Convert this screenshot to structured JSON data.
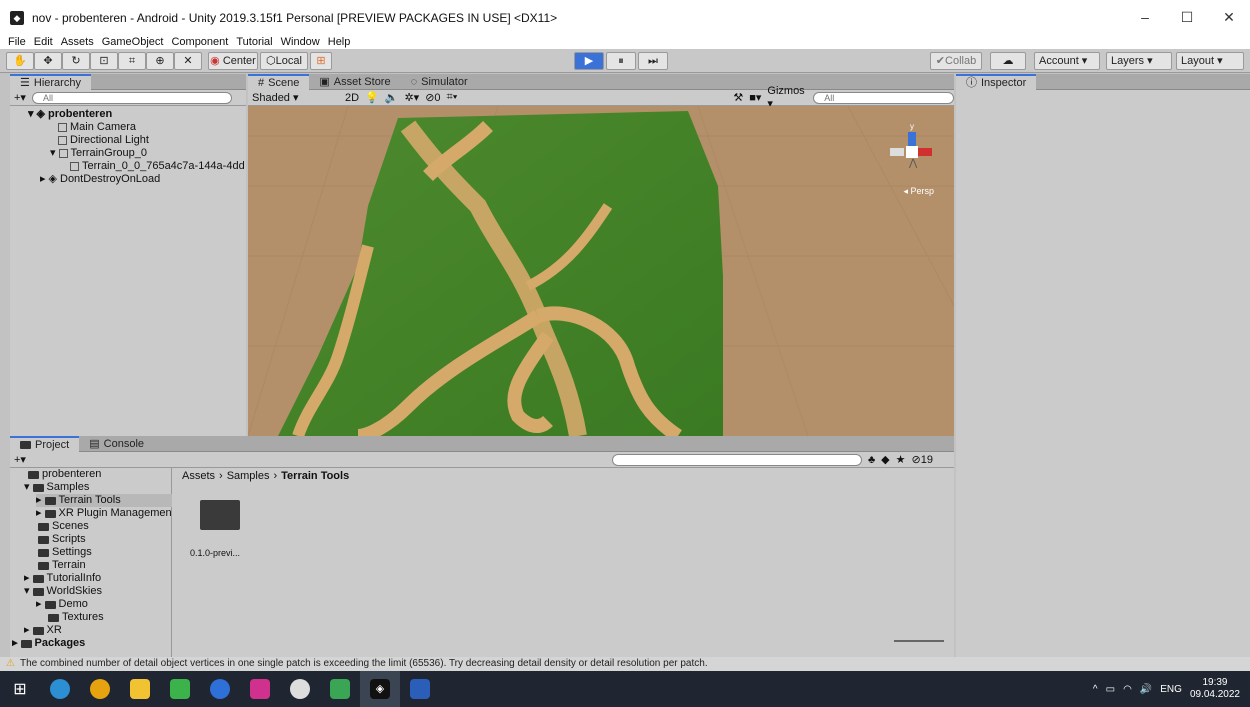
{
  "window": {
    "title": "nov - probenteren - Android - Unity 2019.3.15f1 Personal [PREVIEW PACKAGES IN USE] <DX11>",
    "minimize": "–",
    "maximize": "☐",
    "close": "✕"
  },
  "menu": [
    "File",
    "Edit",
    "Assets",
    "GameObject",
    "Component",
    "Tutorial",
    "Window",
    "Help"
  ],
  "toolbar": {
    "center": "Center",
    "local": "Local",
    "collab": "Collab",
    "account": "Account",
    "layers": "Layers",
    "layout": "Layout"
  },
  "hierarchy": {
    "tab": "Hierarchy",
    "search_placeholder": "All",
    "items": [
      {
        "label": "probenteren"
      },
      {
        "label": "Main Camera"
      },
      {
        "label": "Directional Light"
      },
      {
        "label": "TerrainGroup_0"
      },
      {
        "label": "Terrain_0_0_765a4c7a-144a-4dd"
      },
      {
        "label": "DontDestroyOnLoad"
      }
    ]
  },
  "scene": {
    "tabs": [
      "Scene",
      "Asset Store",
      "Simulator"
    ],
    "shading": "Shaded",
    "mode_2d": "2D",
    "fx_count": "0",
    "gizmos": "Gizmos",
    "search_placeholder": "All",
    "persp": "Persp"
  },
  "inspector": {
    "tab": "Inspector"
  },
  "project": {
    "tabs": [
      "Project",
      "Console"
    ],
    "counter": "19",
    "breadcrumb": [
      "Assets",
      "Samples",
      "Terrain Tools"
    ],
    "tree": [
      "probenteren",
      "Samples",
      "Terrain Tools",
      "XR Plugin Managemen",
      "Scenes",
      "Scripts",
      "Settings",
      "Terrain",
      "TutorialInfo",
      "WorldSkies",
      "Demo",
      "Textures",
      "XR",
      "Packages"
    ],
    "asset": "0.1.0-previ..."
  },
  "status": "The combined number of detail object vertices in one single patch is exceeding the limit (65536). Try decreasing detail density or detail resolution per patch.",
  "taskbar": {
    "time": "19:39",
    "date": "09.04.2022",
    "lang": "ENG"
  }
}
